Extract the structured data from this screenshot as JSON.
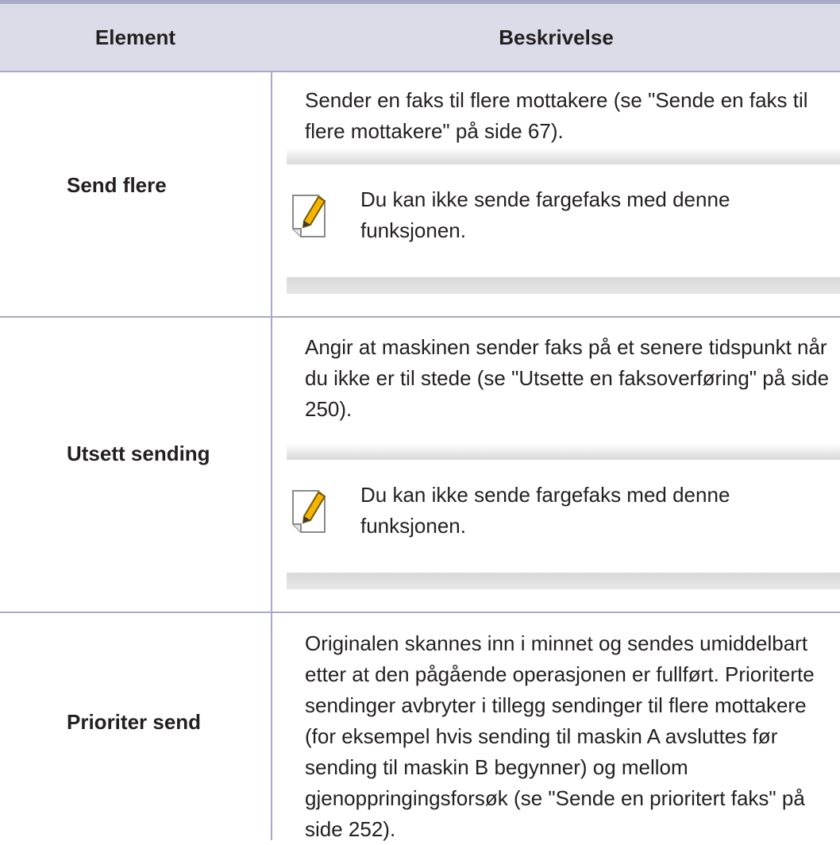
{
  "header": {
    "col_element": "Element",
    "col_description": "Beskrivelse"
  },
  "rows": [
    {
      "element": "Send flere",
      "description": "Sender en faks til flere mottakere (se \"Sende en faks til flere mottakere\" på side 67).",
      "note": "Du kan ikke sende fargefaks med denne funksjonen.",
      "note_icon": "pencil-note-icon"
    },
    {
      "element": "Utsett sending",
      "description": "Angir at maskinen sender faks på et senere tidspunkt når du ikke er til stede (se \"Utsette en faksoverføring\" på side 250).",
      "note": "Du kan ikke sende fargefaks med denne funksjonen.",
      "note_icon": "pencil-note-icon"
    },
    {
      "element": "Prioriter send",
      "description": "Originalen skannes inn i minnet og sendes umiddelbart etter at den pågående operasjonen er fullført. Prioriterte sendinger avbryter i tillegg sendinger til flere mottakere (for eksempel hvis sending til maskin A avsluttes før sending til maskin B begynner) og mellom gjenoppringingsforsøk (se \"Sende en prioritert faks\" på side 252)."
    }
  ],
  "colors": {
    "header_bg": "#dcdce9",
    "rule": "#a9a9c9",
    "note_bar": "#d9d9d9",
    "icon_accent": "#f5b400"
  }
}
